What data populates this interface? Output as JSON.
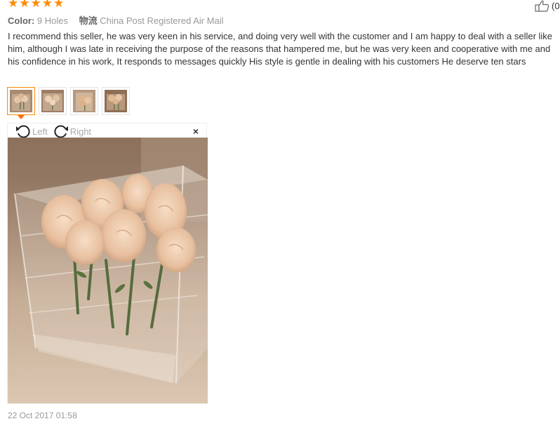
{
  "rating": {
    "stars": 5,
    "color": "#ff8a00"
  },
  "helpful": {
    "count": "(0"
  },
  "meta": {
    "color_label": "Color:",
    "color_value": "9 Holes",
    "shipping_label": "物流",
    "shipping_value": "China Post Registered Air Mail"
  },
  "review_text": "I recommend this seller, he was very keen in his service, and doing very well with the customer and I am happy to deal with a seller like him, although I was late in receiving the purpose of the reasons that hampered me, but he was very keen and cooperative with me and his confidence in his work, It responds to messages quickly His style is gentle in dealing with his customers He deserve ten stars",
  "thumbnails": [
    {
      "name": "photo-1",
      "active": true
    },
    {
      "name": "photo-2",
      "active": false
    },
    {
      "name": "photo-3",
      "active": false
    },
    {
      "name": "photo-4",
      "active": false
    }
  ],
  "viewer": {
    "rotate_left_label": "Left",
    "rotate_right_label": "Right",
    "close_glyph": "×"
  },
  "date": "22 Oct 2017 01:58",
  "colors": {
    "accent": "#ff8a00",
    "arrow": "#ff6a00"
  }
}
